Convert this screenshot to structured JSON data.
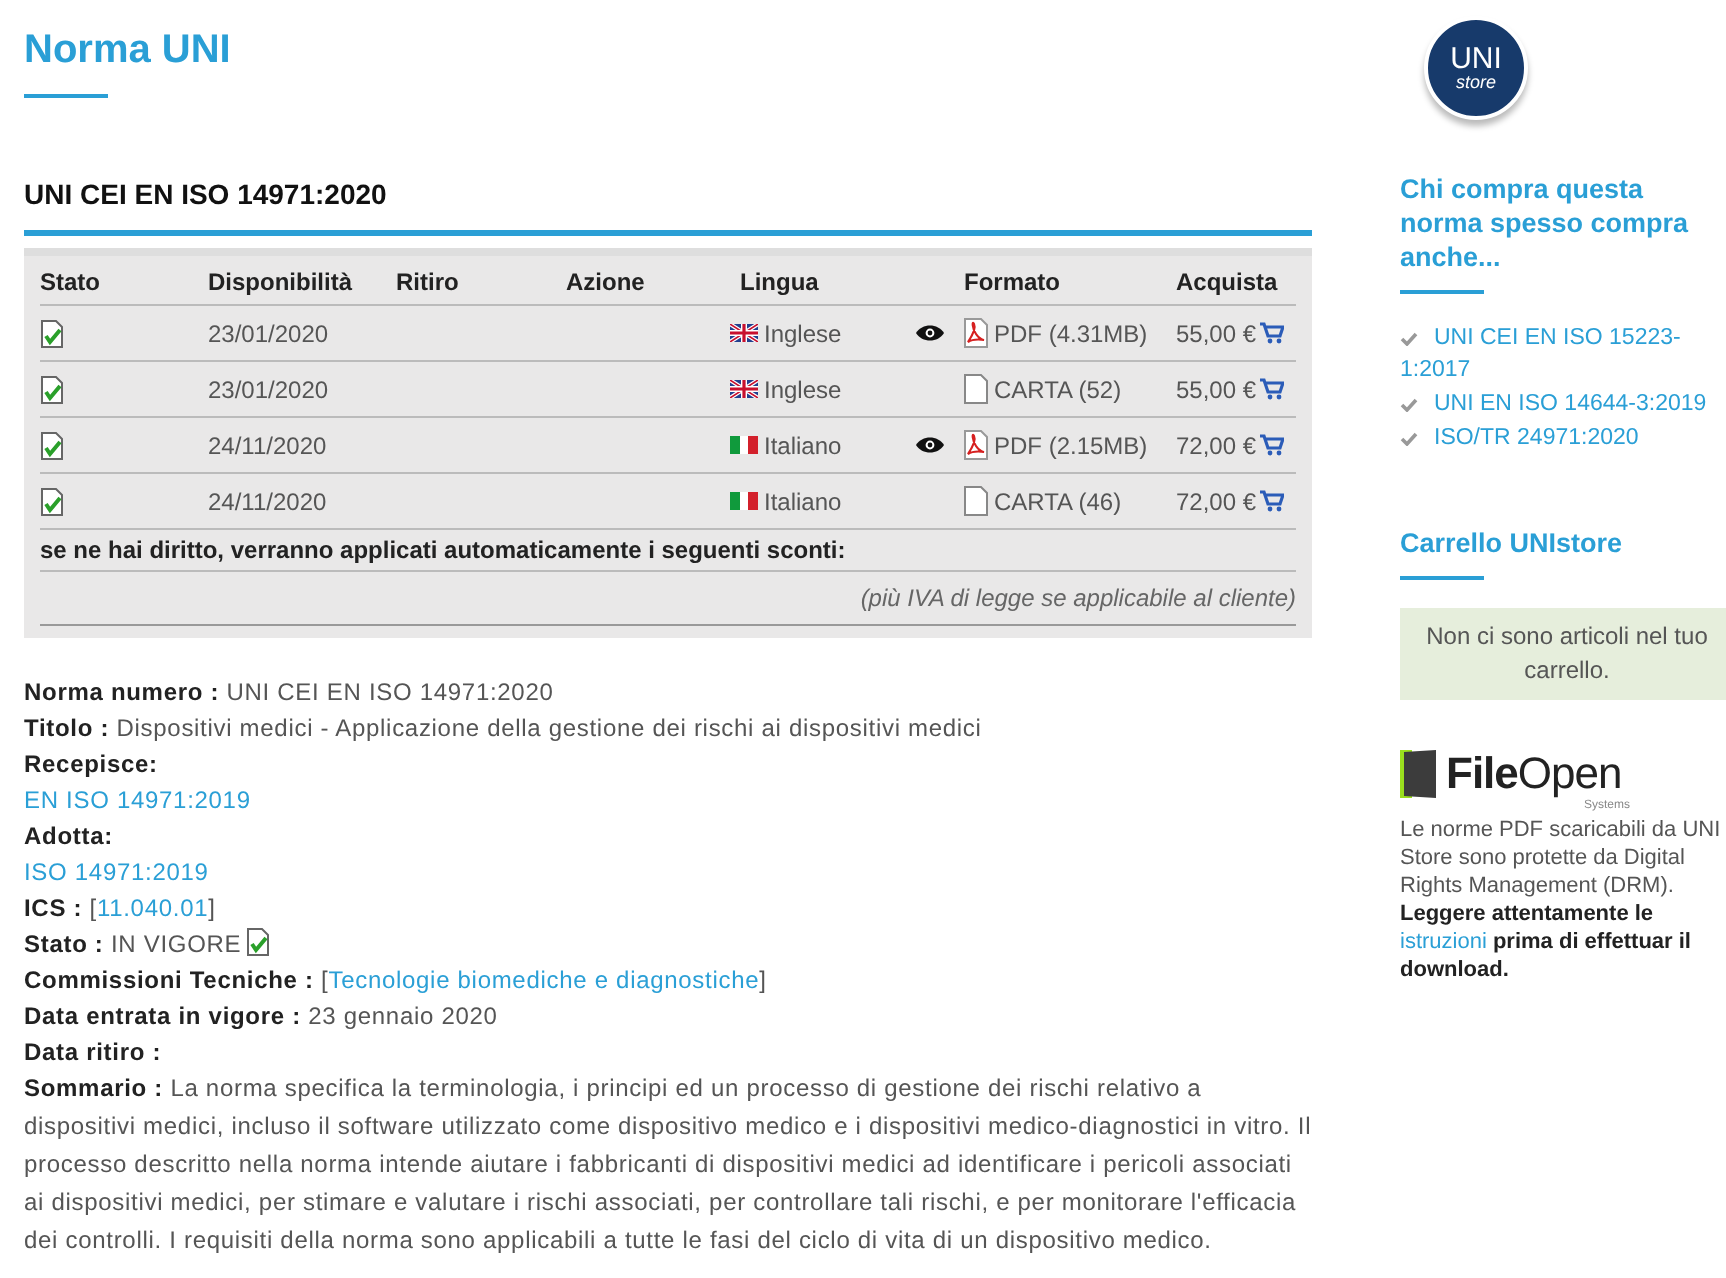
{
  "page_title": "Norma UNI",
  "standard_heading": "UNI CEI EN ISO 14971:2020",
  "table": {
    "columns": [
      "Stato",
      "Disponibilità",
      "Ritiro",
      "Azione",
      "Lingua",
      "",
      "Formato",
      "Acquista"
    ],
    "rows": [
      {
        "availability": "23/01/2020",
        "language": {
          "kind": "uk",
          "label": "Inglese"
        },
        "preview": true,
        "format": {
          "kind": "pdf",
          "label": "PDF (4.31MB)"
        },
        "price": "55,00 €"
      },
      {
        "availability": "23/01/2020",
        "language": {
          "kind": "uk",
          "label": "Inglese"
        },
        "preview": false,
        "format": {
          "kind": "paper",
          "label": "CARTA (52)"
        },
        "price": "55,00 €"
      },
      {
        "availability": "24/11/2020",
        "language": {
          "kind": "it",
          "label": "Italiano"
        },
        "preview": true,
        "format": {
          "kind": "pdf",
          "label": "PDF (2.15MB)"
        },
        "price": "72,00 €"
      },
      {
        "availability": "24/11/2020",
        "language": {
          "kind": "it",
          "label": "Italiano"
        },
        "preview": false,
        "format": {
          "kind": "paper",
          "label": "CARTA (46)"
        },
        "price": "72,00 €"
      }
    ],
    "discount_note": "se ne hai diritto, verranno applicati automaticamente i seguenti sconti:",
    "vat_note": "(più IVA di legge se applicabile al cliente)"
  },
  "details": [
    {
      "kind": "text",
      "label": "Norma numero :",
      "value": "UNI CEI EN ISO 14971:2020"
    },
    {
      "kind": "text",
      "label": "Titolo :",
      "value": "Dispositivi medici - Applicazione della gestione dei rischi ai dispositivi medici"
    },
    {
      "kind": "link_below",
      "label": "Recepisce:",
      "value": "EN ISO 14971:2019"
    },
    {
      "kind": "link_below",
      "label": "Adotta:",
      "value": "ISO 14971:2019"
    },
    {
      "kind": "bracket_link",
      "label": "ICS :",
      "open": "[",
      "value": "11.040.01",
      "close": "]"
    },
    {
      "kind": "status",
      "label": "Stato :",
      "value": "IN VIGORE"
    },
    {
      "kind": "bracket_link",
      "label": "Commissioni Tecniche :",
      "open": "[",
      "value": "Tecnologie biomediche e diagnostiche",
      "close": "]"
    },
    {
      "kind": "text",
      "label": "Data entrata in vigore :",
      "value": "23 gennaio 2020"
    },
    {
      "kind": "text",
      "label": "Data ritiro :"
    },
    {
      "kind": "paragraph",
      "label": "Sommario :",
      "value": "La norma specifica la terminologia, i principi ed un processo di gestione dei rischi relativo a dispositivi medici, incluso il software utilizzato come dispositivo medico e i dispositivi medico-diagnostici in vitro. Il processo descritto nella norma intende aiutare i fabbricanti di dispositivi medici ad identificare i pericoli associati ai dispositivi medici, per stimare e valutare i rischi associati, per controllare tali rischi, e per monitorare l'efficacia dei controlli. I requisiti della norma sono applicabili a tutte le fasi del ciclo di vita di un dispositivo medico."
    }
  ],
  "sidebar": {
    "logo": {
      "top": "UNI",
      "bottom": "store"
    },
    "related_heading": "Chi compra questa norma spesso compra anche...",
    "related": [
      "UNI CEI EN ISO 15223-1:2017",
      "UNI EN ISO 14644-3:2019",
      "ISO/TR 24971:2020"
    ],
    "cart_heading": "Carrello UNIstore",
    "cart_message": "Non ci sono articoli nel tuo carrello.",
    "fileopen": {
      "brand_bold": "File",
      "brand_light": "Open",
      "sub": "Systems"
    },
    "drm_text": "Le norme PDF scaricabili da UNI Store sono protette da Digital Rights Management (DRM).",
    "notice": {
      "before": "Leggere attentamente le",
      "link": "istruzioni",
      "after": "prima di effettuar il download."
    }
  }
}
